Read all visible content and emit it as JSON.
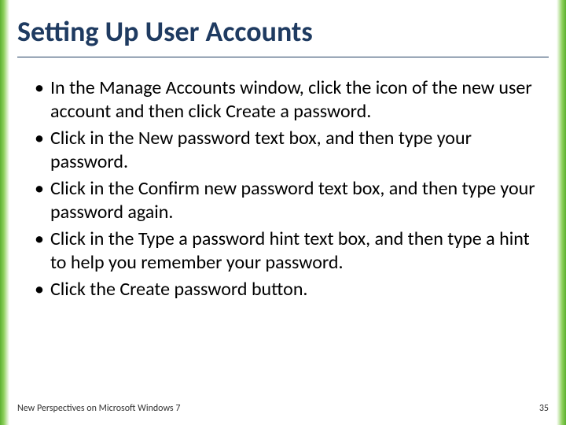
{
  "title": "Setting Up User Accounts",
  "bullets": [
    "In the Manage Accounts window, click the icon of the new user account and then click Create a password.",
    "Click in the New password text box, and then type your password.",
    "Click in the Confirm new password text box, and then type your password again.",
    "Click in the Type a password hint text box, and then type a hint to help you remember your password.",
    "Click the Create password button."
  ],
  "footer": {
    "source": "New Perspectives on Microsoft Windows 7",
    "page": "35"
  }
}
